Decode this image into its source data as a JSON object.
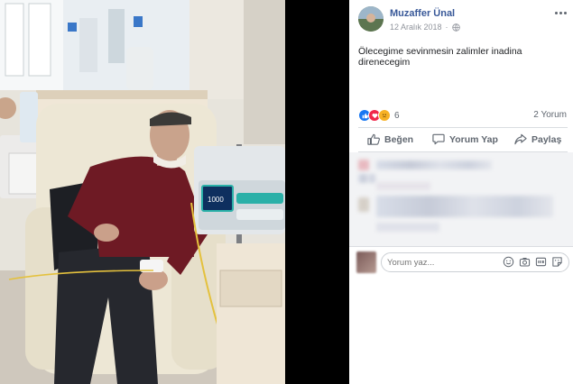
{
  "post": {
    "author": "Muzaffer Ünal",
    "date": "12 Aralık 2018",
    "text": "Ölecegime sevinmesin zalimler inadina direnecegim"
  },
  "reactions": {
    "count": "6",
    "comments": "2 Yorum"
  },
  "actions": {
    "like": "Beğen",
    "comment": "Yorum Yap",
    "share": "Paylaş"
  },
  "composer": {
    "placeholder": "Yorum yaz..."
  },
  "device": {
    "display_value": "1000"
  },
  "colors": {
    "link": "#385898",
    "like_blue": "#1877f2",
    "love_red": "#f0284a",
    "haha_yellow": "#f7b125"
  }
}
